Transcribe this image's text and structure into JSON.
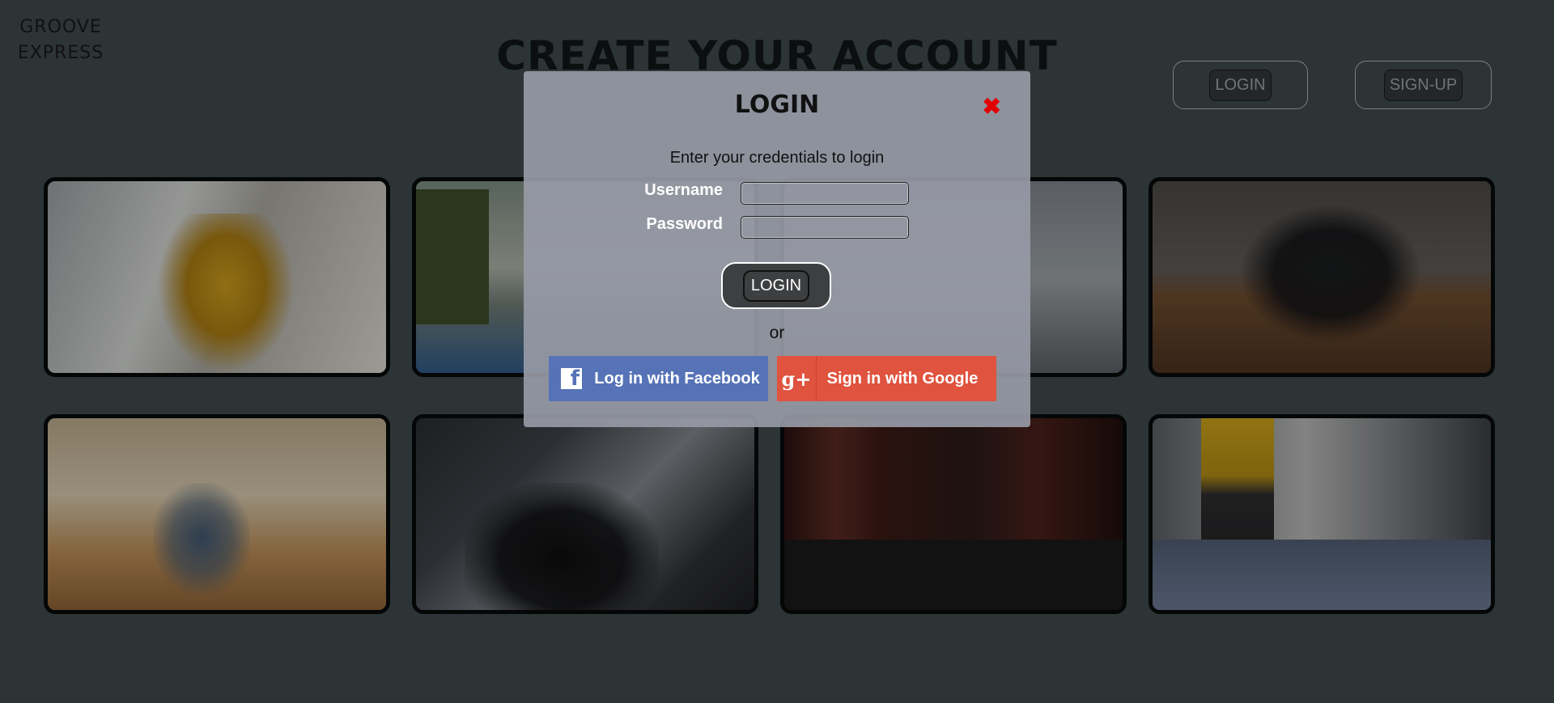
{
  "brand": {
    "line1": "GROOVE",
    "line2": "EXPRESS"
  },
  "page": {
    "title": "CREATE YOUR ACCOUNT"
  },
  "nav": {
    "login_label": "LOGIN",
    "signup_label": "SIGN-UP"
  },
  "modal": {
    "title": "LOGIN",
    "close_icon": "close-icon",
    "subtitle": "Enter your credentials to login",
    "username_label": "Username",
    "username_value": "",
    "password_label": "Password",
    "password_value": "",
    "submit_label": "LOGIN",
    "or_text": "or",
    "facebook_label": "Log in with Facebook",
    "google_label": "Sign in with Google"
  },
  "gallery": {
    "items": [
      {
        "name": "dancer-yellow-shirt"
      },
      {
        "name": "dancer-outdoor-bridge"
      },
      {
        "name": "dancer-street"
      },
      {
        "name": "dance-group-studio"
      },
      {
        "name": "dancer-chairs-room"
      },
      {
        "name": "dancer-dark-hall"
      },
      {
        "name": "dancer-red-curtains"
      },
      {
        "name": "dancer-ballet-barre"
      }
    ]
  },
  "colors": {
    "background": "#2c3436",
    "modal": "#979aa6",
    "close": "#e00000",
    "facebook": "#5673b8",
    "google": "#e0533f"
  }
}
